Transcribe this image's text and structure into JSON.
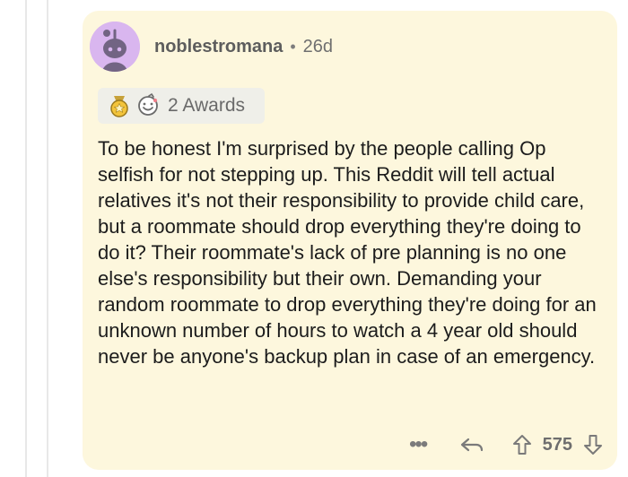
{
  "comment": {
    "username": "noblestromana",
    "separator": "•",
    "age": "26d",
    "awards": {
      "label": "2 Awards",
      "icons": [
        "gold-medal-icon",
        "smiling-award-icon"
      ]
    },
    "body": "To be honest I'm surprised by the people calling Op selfish for not stepping up. This Reddit will tell actual relatives it's not their responsibility to provide child care, but a roommate should drop everything they're doing to do it? Their roommate's lack of pre planning is no one else's responsibility but their own. Demanding your random roommate to drop everything they're doing for an unknown number of hours to watch a 4 year old should never be anyone's backup plan in case of an emergency.",
    "actions": {
      "more_label": "•••",
      "vote_score": "575",
      "icons": [
        "reply-icon",
        "upvote-icon",
        "downvote-icon"
      ]
    }
  },
  "colors": {
    "card_background": "#fdf7dd",
    "avatar_background": "#d9b6ef",
    "avatar_character": "#726483",
    "award_box": "#efefe9",
    "award_gold": "#f3c43b",
    "text_primary": "#1c1c1c",
    "text_secondary": "#6f6f6f"
  }
}
